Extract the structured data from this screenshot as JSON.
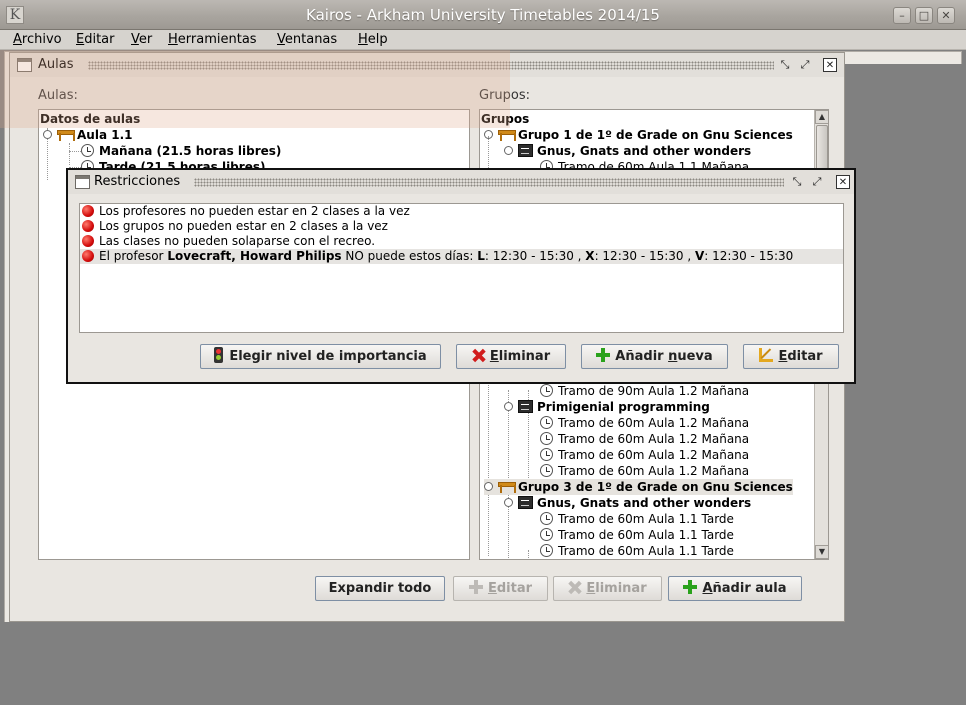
{
  "window": {
    "title": "Kairos - Arkham University Timetables 2014/15",
    "app_icon": "K",
    "controls": [
      "minimize-icon",
      "maximize-icon",
      "close-icon"
    ]
  },
  "menubar": {
    "items": [
      {
        "mnemonic": "A",
        "rest": "rchivo"
      },
      {
        "mnemonic": "E",
        "rest": "ditar"
      },
      {
        "mnemonic": "V",
        "rest": "er"
      },
      {
        "mnemonic": "H",
        "rest": "erramientas"
      },
      {
        "mnemonic": "V",
        "rest": "entanas"
      },
      {
        "mnemonic": "H",
        "rest": "elp"
      }
    ]
  },
  "aulas_frame": {
    "title": "Aulas",
    "left_pane": {
      "title": "Aulas:",
      "tree": [
        {
          "text": "Datos de aulas"
        },
        {
          "text": "Aula 1.1"
        },
        {
          "text": "Mañana  (21.5 horas libres)"
        },
        {
          "text": "Tarde  (21.5 horas libres)"
        }
      ]
    },
    "right_pane": {
      "title": "Grupos:",
      "tree_top": [
        {
          "text": "Grupos"
        },
        {
          "text": "Grupo 1 de 1º de Grade on Gnu Sciences"
        },
        {
          "text": "Gnus, Gnats and other wonders"
        },
        {
          "text": "Tramo de 60m Aula 1.1 Mañana"
        }
      ],
      "tree_bottom": [
        {
          "text": "Tramo de 90m Aula 1.2 Mañana"
        },
        {
          "text": "Primigenial programming"
        },
        {
          "text": "Tramo de 60m Aula 1.2 Mañana"
        },
        {
          "text": "Tramo de 60m Aula 1.2 Mañana"
        },
        {
          "text": "Tramo de 60m Aula 1.2 Mañana"
        },
        {
          "text": "Tramo de 60m Aula 1.2 Mañana"
        },
        {
          "text": "Grupo 3 de 1º de Grade on Gnu Sciences"
        },
        {
          "text": "Gnus, Gnats and other wonders"
        },
        {
          "text": "Tramo de 60m Aula 1.1 Tarde"
        },
        {
          "text": "Tramo de 60m Aula 1.1 Tarde"
        },
        {
          "text": "Tramo de 60m Aula 1.1 Tarde"
        }
      ]
    },
    "buttons": {
      "expand": "Expandir todo",
      "edit_mn": "E",
      "edit_rest": "ditar",
      "delete_mn": "E",
      "delete_rest": "liminar",
      "add_mn": "A",
      "add_rest": "ñadir aula"
    }
  },
  "restricciones_frame": {
    "title": "Restricciones",
    "rows": [
      {
        "text": "Los profesores no pueden estar en 2 clases a la vez"
      },
      {
        "text": "Los grupos no pueden estar en 2 clases a la vez"
      },
      {
        "text": "Las clases no pueden solaparse con el recreo."
      },
      {
        "prefix": "El profesor ",
        "teacher": "Lovecraft, Howard Philips",
        "mid": " NO puede estos días: ",
        "d1": "L",
        "t1": ": 12:30 - 15:30 , ",
        "d2": "X",
        "t2": ": 12:30 - 15:30 , ",
        "d3": "V",
        "t3": ": 12:30 - 15:30"
      }
    ],
    "buttons": {
      "importance": "Elegir nivel de importancia",
      "delete_mn": "E",
      "delete_rest": "liminar",
      "add_pre": "Añadir ",
      "add_mn": "n",
      "add_rest": "ueva",
      "edit_mn": "E",
      "edit_rest": "ditar"
    }
  },
  "colors": {
    "desktop": "#808080",
    "window_bg": "#e9e6e1",
    "title_text": "#ffffff",
    "error_dot": "#d30b0b",
    "add_icon": "#2aa21c",
    "delete_icon": "#d11c1c"
  }
}
